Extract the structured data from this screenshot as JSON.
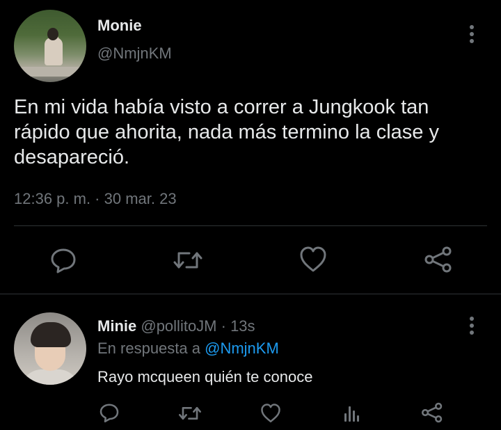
{
  "tweet": {
    "author_name": "Monie",
    "author_handle": "@NmjnKM",
    "text_line1": "En mi vida había visto a correr a Jungkook tan",
    "text_line2": "rápido que ahorita, nada más termino la clase y",
    "text_line3": "desapareció.",
    "timestamp": "12:36 p. m. · 30 mar. 23"
  },
  "reply": {
    "author_name": "Minie",
    "author_handle": "@pollitoJM",
    "time": "· 13s",
    "replying_prefix": "En respuesta a",
    "replying_to": "@NmjnKM",
    "text": "Rayo mcqueen quién te conoce"
  },
  "icons": {
    "tweet_actions": [
      "reply-icon",
      "retweet-icon",
      "like-icon",
      "share-icon"
    ],
    "reply_actions": [
      "reply-icon",
      "retweet-icon",
      "like-icon",
      "views-icon",
      "share-icon"
    ],
    "more": "more-vertical-icon"
  },
  "colors": {
    "background": "#000000",
    "text": "#e7e9ea",
    "muted": "#71767b",
    "link": "#1d9bf0",
    "divider": "#2f3336"
  }
}
